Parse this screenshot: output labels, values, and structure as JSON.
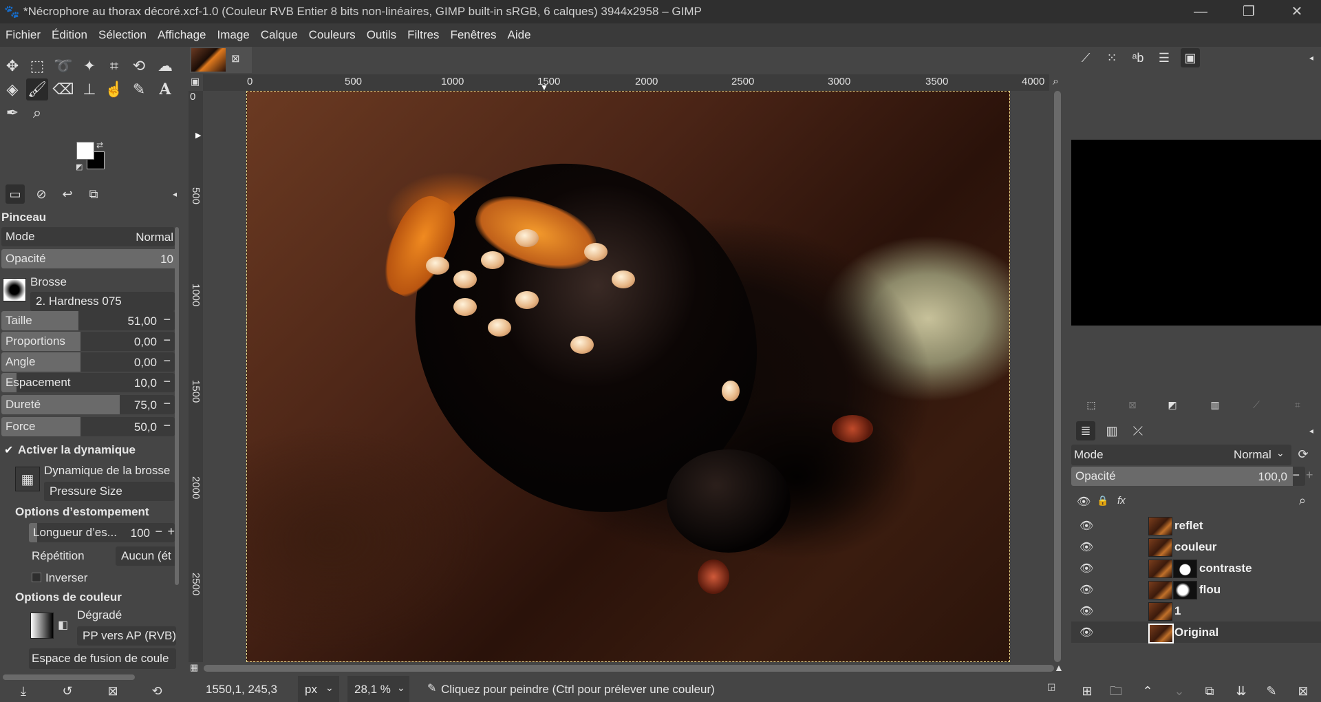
{
  "window": {
    "title": "*Nécrophore au thorax décoré.xcf-1.0 (Couleur RVB Entier 8 bits non-linéaires, GIMP built-in sRGB, 6 calques) 3944x2958 – GIMP",
    "minimize": "—",
    "restore": "❐",
    "close": "✕"
  },
  "menu": [
    "Fichier",
    "Édition",
    "Sélection",
    "Affichage",
    "Image",
    "Calque",
    "Couleurs",
    "Outils",
    "Filtres",
    "Fenêtres",
    "Aide"
  ],
  "tool_options": {
    "heading": "Pinceau",
    "mode_label": "Mode",
    "mode_value": "Normal",
    "opacity_label": "Opacité",
    "opacity_value": "10",
    "brush_label": "Brosse",
    "brush_value": "2. Hardness 075",
    "size_label": "Taille",
    "size_value": "51,00",
    "aspect_label": "Proportions",
    "aspect_value": "0,00",
    "angle_label": "Angle",
    "angle_value": "0,00",
    "spacing_label": "Espacement",
    "spacing_value": "10,0",
    "hardness_label": "Dureté",
    "hardness_value": "75,0",
    "force_label": "Force",
    "force_value": "50,0",
    "dynamics_toggle": "Activer la dynamique",
    "dynamics_label": "Dynamique de la brosse",
    "dynamics_value": "Pressure Size",
    "fade_heading": "Options d’estompement",
    "fade_length_label": "Longueur d’es...",
    "fade_length_value": "100",
    "repeat_label": "Répétition",
    "repeat_value": "Aucun (ét",
    "reverse_label": "Inverser",
    "color_heading": "Options de couleur",
    "gradient_label": "Dégradé",
    "gradient_value": "PP vers AP (RVB)",
    "blend_space_label": "Espace de fusion de coule"
  },
  "rulers": {
    "h_ticks": [
      "0",
      "500",
      "1000",
      "1500",
      "2000",
      "2500",
      "3000",
      "3500",
      "4000"
    ],
    "v_ticks": [
      "0",
      "500",
      "1000",
      "1500",
      "2000",
      "2500"
    ]
  },
  "status": {
    "coords": "1550,1, 245,3",
    "unit": "px",
    "zoom": "28,1 %",
    "message": "Cliquez pour peindre (Ctrl pour prélever une couleur)"
  },
  "layers_panel": {
    "mode_label": "Mode",
    "mode_value": "Normal",
    "opacity_label": "Opacité",
    "opacity_value": "100,0",
    "layers": [
      {
        "name": "reflet",
        "has_mask": false
      },
      {
        "name": "couleur",
        "has_mask": false
      },
      {
        "name": "contraste",
        "has_mask": true
      },
      {
        "name": "flou",
        "has_mask": true
      },
      {
        "name": "1",
        "has_mask": false
      },
      {
        "name": "Original",
        "has_mask": false
      }
    ]
  },
  "colors": {
    "accent_selection": "#e8d88a",
    "panel_bg": "#454545",
    "field_bg": "#3a3a3a"
  }
}
